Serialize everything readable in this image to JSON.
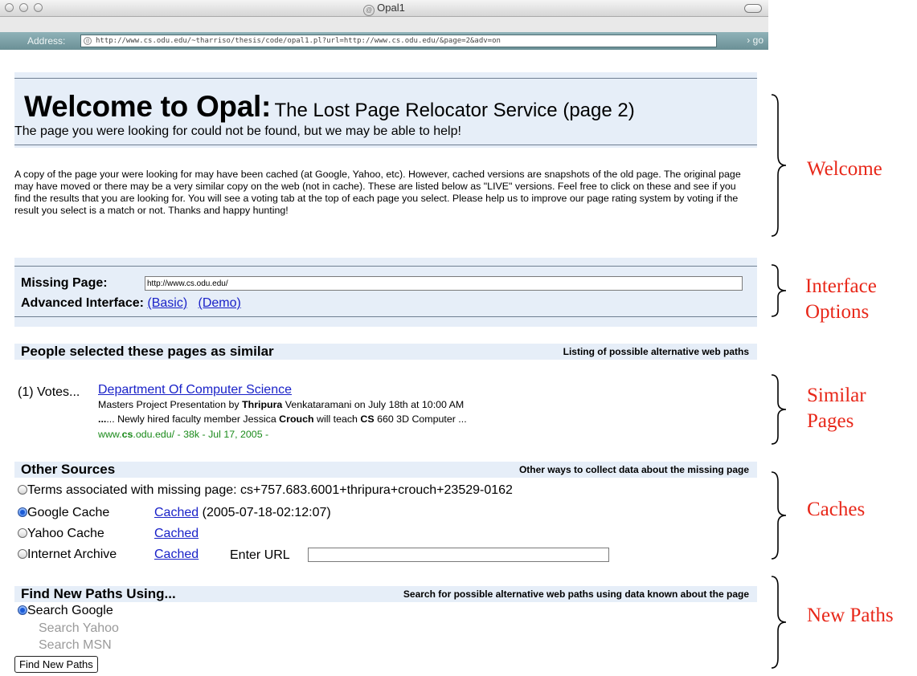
{
  "window": {
    "title": "Opal1"
  },
  "address_bar": {
    "label": "Address:",
    "url": "http://www.cs.odu.edu/~tharriso/thesis/code/opal1.pl?url=http://www.cs.odu.edu/&page=2&adv=on",
    "go_label": "go"
  },
  "welcome": {
    "title_big": "Welcome to Opal:",
    "title_small": "The Lost Page Relocator Service (page 2)",
    "subtitle": "The page you were looking for could not be found, but we may be able to help!",
    "intro": "A copy of the page your were looking for may have been cached (at Google, Yahoo, etc). However, cached versions are snapshots of the old page. The original page may have moved or there may be a very similar copy on the web (not in cache). These are listed below as \"LIVE\" versions. Feel free to click on these and see if you find the results that you are looking for. You will see a voting tab at the top of each page you select. Please help us to improve our page rating system by voting if the result you select is a match or not. Thanks and happy hunting!"
  },
  "interface": {
    "missing_label": "Missing Page:",
    "missing_value": "http://www.cs.odu.edu/",
    "advanced_label": "Advanced Interface:",
    "basic_link": "(Basic)",
    "demo_link": "(Demo)"
  },
  "similar": {
    "title": "People selected these pages as similar",
    "right": "Listing of possible alternative web paths",
    "result": {
      "votes": "(1) Votes...",
      "title": "Department Of Computer Science",
      "snippet1_pre": "Masters Project Presentation by ",
      "snippet1_bold": "Thripura",
      "snippet1_post": " Venkataramani on July 18th at 10:00 AM",
      "snippet2_a": "... Newly hired faculty member Jessica ",
      "snippet2_b": "Crouch",
      "snippet2_c": " will teach ",
      "snippet2_d": "CS",
      "snippet2_e": " 660 3D Computer ...",
      "url_a": "www.",
      "url_b": "cs",
      "url_c": ".odu.edu/ - 38k - Jul 17, 2005 -"
    }
  },
  "sources": {
    "title": "Other Sources",
    "right": "Other ways to collect data about the missing page",
    "terms": "Terms associated with missing page: cs+757.683.6001+thripura+crouch+23529-0162",
    "google": "Google Cache",
    "google_link": "Cached",
    "google_date": "(2005-07-18-02:12:07)",
    "yahoo": "Yahoo Cache",
    "yahoo_link": "Cached",
    "archive": "Internet Archive",
    "archive_link": "Cached",
    "enter_url": "Enter URL",
    "selected": "Google Cache"
  },
  "newpaths": {
    "title": "Find New Paths Using...",
    "right": "Search for possible alternative web paths using data known about the page",
    "google": "Search Google",
    "yahoo": "Search Yahoo",
    "msn": "Search MSN",
    "button": "Find New Paths",
    "selected": "Search Google"
  },
  "annotations": {
    "welcome": "Welcome",
    "interface_1": "Interface",
    "interface_2": "Options",
    "similar_1": "Similar",
    "similar_2": "Pages",
    "caches": "Caches",
    "newpaths": "New Paths",
    "color": "#e8281a"
  }
}
